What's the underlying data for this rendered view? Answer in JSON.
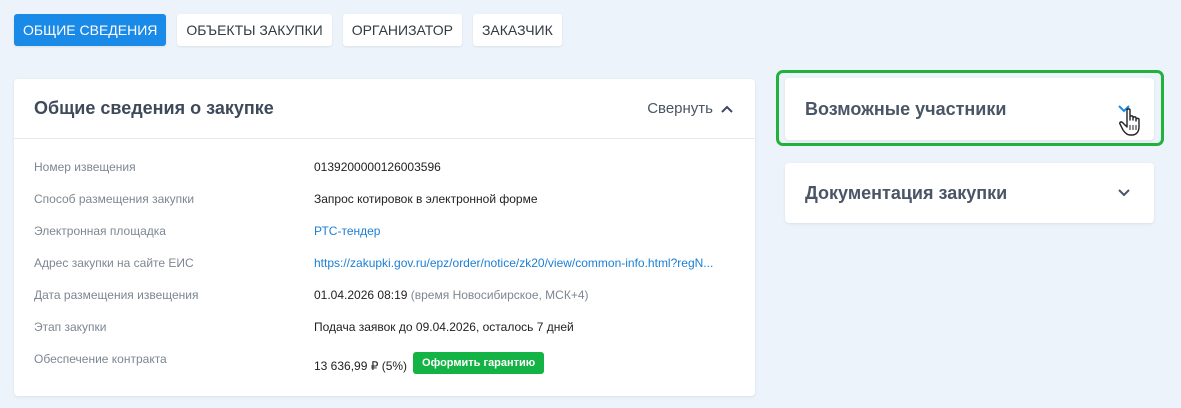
{
  "tabs": [
    {
      "label": "ОБЩИЕ СВЕДЕНИЯ",
      "active": true
    },
    {
      "label": "ОБЪЕКТЫ ЗАКУПКИ",
      "active": false
    },
    {
      "label": "ОРГАНИЗАТОР",
      "active": false
    },
    {
      "label": "ЗАКАЗЧИК",
      "active": false
    }
  ],
  "main": {
    "title": "Общие сведения о закупке",
    "collapse_label": "Свернуть",
    "rows": [
      {
        "label": "Номер извещения",
        "value": "0139200000126003596"
      },
      {
        "label": "Способ размещения закупки",
        "value": "Запрос котировок в электронной форме"
      },
      {
        "label": "Электронная площадка",
        "value": "РТС-тендер"
      },
      {
        "label": "Адрес закупки на сайте ЕИС",
        "value": "https://zakupki.gov.ru/epz/order/notice/zk20/view/common-info.html?regN..."
      },
      {
        "label": "Дата размещения извещения",
        "value": "01.04.2026 08:19",
        "note": "(время Новосибирское, МСК+4)"
      },
      {
        "label": "Этап закупки",
        "value": "Подача заявок до 09.04.2026, осталось 7 дней"
      },
      {
        "label": "Обеспечение контракта",
        "value": "13 636,99 ₽",
        "note": "(5%)",
        "button": "Оформить гарантию"
      }
    ]
  },
  "side": {
    "participants_title": "Возможные участники",
    "docs_title": "Документация закупки"
  },
  "colors": {
    "accent": "#1a8ae8",
    "success": "#14b346",
    "highlight": "#20b23a"
  }
}
